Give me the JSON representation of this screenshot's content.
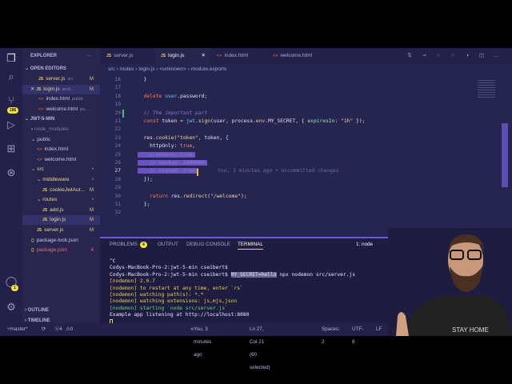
{
  "activity": {
    "icons": [
      "files-icon",
      "search-icon",
      "source-control-icon",
      "run-debug-icon",
      "extensions-icon",
      "git-graph-icon",
      "account-icon",
      "gear-icon"
    ],
    "scm_badge": "186",
    "account_badge": "1"
  },
  "sidebar": {
    "title": "EXPLORER",
    "open_editors": "OPEN EDITORS",
    "open": [
      {
        "name": "server.js",
        "path": "src",
        "mark": "M",
        "type": "js"
      },
      {
        "name": "login.js",
        "path": "src/r...",
        "mark": "M",
        "type": "js"
      },
      {
        "name": "index.html",
        "path": "public",
        "mark": "",
        "type": "html"
      },
      {
        "name": "welcome.html",
        "path": "pu...",
        "mark": "",
        "type": "html"
      }
    ],
    "project": "JWT-5-MIN",
    "tree": [
      {
        "name": "node_modules",
        "indent": 1,
        "kind": "folder",
        "mark": ""
      },
      {
        "name": "public",
        "indent": 1,
        "kind": "folder-open",
        "mark": ""
      },
      {
        "name": "index.html",
        "indent": 2,
        "kind": "html",
        "mark": ""
      },
      {
        "name": "welcome.html",
        "indent": 2,
        "kind": "html",
        "mark": ""
      },
      {
        "name": "src",
        "indent": 1,
        "kind": "folder-open",
        "mark": "•",
        "modified": true
      },
      {
        "name": "middleware",
        "indent": 2,
        "kind": "folder-open",
        "mark": "•",
        "modified": true
      },
      {
        "name": "cookieJwtAut...",
        "indent": 3,
        "kind": "js",
        "mark": "M",
        "modified": true
      },
      {
        "name": "routes",
        "indent": 2,
        "kind": "folder-open",
        "mark": "•",
        "modified": true
      },
      {
        "name": "add.js",
        "indent": 3,
        "kind": "js",
        "mark": "M",
        "modified": true
      },
      {
        "name": "login.js",
        "indent": 3,
        "kind": "js",
        "mark": "M",
        "modified": true,
        "selected": true
      },
      {
        "name": "server.js",
        "indent": 2,
        "kind": "js",
        "mark": "M",
        "modified": true
      },
      {
        "name": "package-lock.json",
        "indent": 1,
        "kind": "json",
        "mark": ""
      },
      {
        "name": "package.json",
        "indent": 1,
        "kind": "json",
        "mark": "4",
        "error": true
      }
    ],
    "outline": "OUTLINE",
    "timeline": "TIMELINE"
  },
  "tabs": [
    {
      "label": "server.js",
      "type": "js"
    },
    {
      "label": "login.js",
      "type": "js",
      "active": true
    },
    {
      "label": "index.html",
      "type": "html"
    },
    {
      "label": "welcome.html",
      "type": "html"
    }
  ],
  "breadcrumb": [
    "src",
    "routes",
    "login.js",
    "<unknown>",
    "module.exports"
  ],
  "editor": {
    "lines": [
      {
        "n": "16",
        "t": [
          [
            "  }",
            ""
          ]
        ]
      },
      {
        "n": "17",
        "t": []
      },
      {
        "n": "18",
        "t": [
          [
            "  delete ",
            "k"
          ],
          [
            "user",
            "v"
          ],
          [
            ".password;",
            ""
          ]
        ]
      },
      {
        "n": "19",
        "t": []
      },
      {
        "n": "20",
        "t": [
          [
            "  // The important part",
            "c"
          ]
        ]
      },
      {
        "n": "21",
        "t": [
          [
            "  const ",
            "k"
          ],
          [
            "token = ",
            ""
          ],
          [
            "jwt",
            "v"
          ],
          [
            ".",
            ""
          ],
          [
            "sign",
            "f"
          ],
          [
            "(user, process.",
            ""
          ],
          [
            "env",
            "f"
          ],
          [
            ".MY_SECRET, { ",
            ""
          ],
          [
            "expiresIn",
            "p"
          ],
          [
            ": ",
            ""
          ],
          [
            "\"1h\"",
            "s"
          ],
          [
            " });",
            ""
          ]
        ]
      },
      {
        "n": "22",
        "t": []
      },
      {
        "n": "23",
        "t": [
          [
            "  res.",
            ""
          ],
          [
            "cookie",
            "f"
          ],
          [
            "(",
            ""
          ],
          [
            "\"token\"",
            "s"
          ],
          [
            ", token, {",
            ""
          ]
        ]
      },
      {
        "n": "24",
        "t": [
          [
            "    httpOnly",
            ""
          ],
          [
            ": ",
            ""
          ],
          [
            "true",
            "t"
          ],
          [
            ",",
            ""
          ]
        ]
      },
      {
        "n": "25",
        "t": [
          [
            "    //secure: true,",
            "c hl"
          ]
        ]
      },
      {
        "n": "26",
        "t": [
          [
            "  ",
            "hl"
          ],
          [
            "  // maxAge: 1000000,",
            "c hl"
          ]
        ]
      },
      {
        "n": "27",
        "t": [
          [
            "  ",
            "hl"
          ],
          [
            "  // signed: true,",
            "c hl"
          ]
        ]
      },
      {
        "n": "28",
        "t": [
          [
            "  });",
            ""
          ]
        ]
      },
      {
        "n": "29",
        "t": []
      },
      {
        "n": "30",
        "t": [
          [
            "    return ",
            "k"
          ],
          [
            "res.",
            ""
          ],
          [
            "redirect",
            "f"
          ],
          [
            "(",
            ""
          ],
          [
            "\"/welcome\"",
            "s"
          ],
          [
            ");",
            ""
          ]
        ]
      },
      {
        "n": "31",
        "t": [
          [
            "  };",
            ""
          ]
        ]
      },
      {
        "n": "32",
        "t": []
      }
    ],
    "current_line": "27",
    "blame": "You, 3 minutes ago • Uncommitted changes"
  },
  "panel": {
    "tabs": [
      "PROBLEMS",
      "OUTPUT",
      "DEBUG CONSOLE",
      "TERMINAL"
    ],
    "problems_count": "4",
    "active": "TERMINAL",
    "terminal_select": "1: node"
  },
  "terminal": {
    "lines": [
      [
        [
          "^C",
          ""
        ]
      ],
      [
        [
          "Codys-MacBook-Pro-2:jwt-5-min cseibert$",
          ""
        ]
      ],
      [
        [
          "Codys-MacBook-Pro-2:jwt-5-min cseibert$ ",
          ""
        ],
        [
          "MY_SECRET=hello",
          "sel2"
        ],
        [
          " npx nodemon src/server.js",
          ""
        ]
      ],
      [
        [
          "[nodemon] 2.0.7",
          "y"
        ]
      ],
      [
        [
          "[nodemon] to restart at any time, enter `rs`",
          "y"
        ]
      ],
      [
        [
          "[nodemon] watching path(s): *.*",
          "y"
        ]
      ],
      [
        [
          "[nodemon] watching extensions: js,mjs,json",
          "y"
        ]
      ],
      [
        [
          "[nodemon] starting `node src/server.js`",
          "g"
        ]
      ],
      [
        [
          "Example app listening at http://localhost:8080",
          ""
        ]
      ]
    ]
  },
  "status": {
    "branch": "master*",
    "errors": "4",
    "warnings": "0",
    "blame": "You, 3 minutes ago",
    "position": "Ln 27, Col 21 (60 selected)",
    "spaces": "Spaces: 2",
    "encoding": "UTF-8",
    "eol": "LF"
  },
  "webcam": {
    "shirt_text": "STAY HOME"
  }
}
